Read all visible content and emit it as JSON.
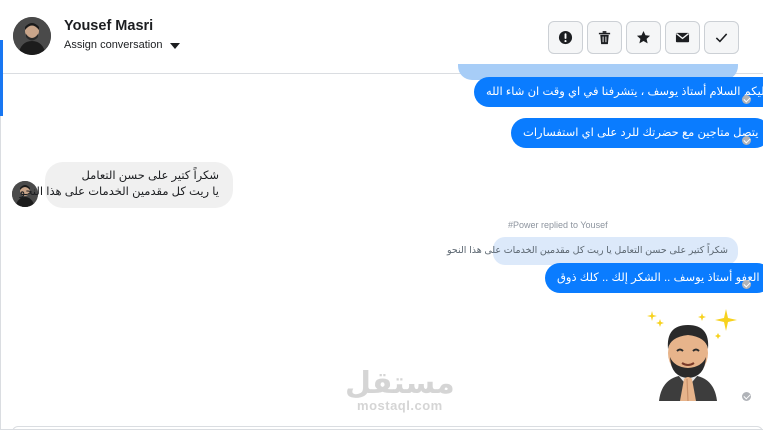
{
  "header": {
    "contact_name": "Yousef Masri",
    "assign_label": "Assign conversation",
    "tools": [
      {
        "icon": "alert-icon",
        "label": "spam"
      },
      {
        "icon": "trash-icon",
        "label": "delete"
      },
      {
        "icon": "star-icon",
        "label": "follow up"
      },
      {
        "icon": "envelope-icon",
        "label": "mark unread"
      },
      {
        "icon": "check-icon",
        "label": "done"
      }
    ]
  },
  "messages": {
    "m1": "و عليكم السلام أستاذ يوسف ، يتشرفنا في اي وقت ان شاء الله",
    "m2": "يتصل متاجين مع حضرتك للرد على اي استفسارات",
    "m3_line1": "شكراً كتير على حسن التعامل",
    "m3_line2": "يا ريت كل مقدمين الخدمات على هذا النحو",
    "replied_note": "#Power replied to Yousef",
    "quoted_text": "شكراً كتير على حسن التعامل يا ريت كل مقدمين الخدمات على هذا النحو",
    "m4": "العفو أستاذ يوسف .. الشكر إلك .. كلك ذوق"
  },
  "watermark": {
    "arabic": "مستقل",
    "latin": "mostaql.com"
  },
  "colors": {
    "outgoing": "#0a7cff",
    "incoming": "#f0f0f0",
    "accent": "#1877f2"
  }
}
